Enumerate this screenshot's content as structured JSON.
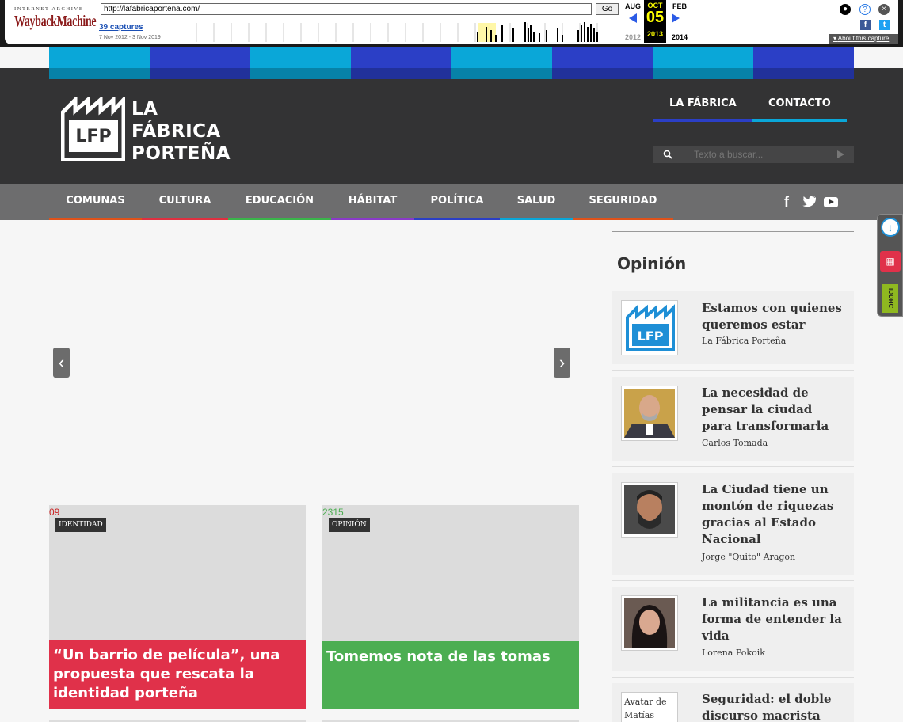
{
  "wayback": {
    "archive_label": "INTERNET ARCHIVE",
    "logo_label": "WaybackMachine",
    "url": "http://lafabricaportena.com/",
    "go_label": "Go",
    "captures_label": "39 captures",
    "date_range": "7 Nov 2012 - 3 Nov 2019",
    "prev_month": "AUG",
    "cur_month": "OCT",
    "next_month": "FEB",
    "cur_day": "05",
    "prev_year": "2012",
    "cur_year": "2013",
    "next_year": "2014",
    "about_label": "About this capture"
  },
  "strip_colors": [
    "#0aa7d8",
    "#2b3fc6",
    "#0aa7d8",
    "#2b3fc6",
    "#0aa7d8",
    "#2b3fc6",
    "#0aa7d8",
    "#2b3fc6"
  ],
  "header": {
    "logo_mark": "LFP",
    "logo_line1": "LA",
    "logo_line2": "FÁBRICA",
    "logo_line3": "PORTEÑA",
    "nav": [
      {
        "label": "LA FÁBRICA",
        "color": "#2b3fc6"
      },
      {
        "label": "CONTACTO",
        "color": "#0aa7d8"
      }
    ],
    "search_placeholder": "Texto a buscar..."
  },
  "categories": [
    {
      "label": "COMUNAS",
      "color": "#e0521a"
    },
    {
      "label": "CULTURA",
      "color": "#e03040"
    },
    {
      "label": "EDUCACIÓN",
      "color": "#3ab54a"
    },
    {
      "label": "HÁBITAT",
      "color": "#8a3ac8"
    },
    {
      "label": "POLÍTICA",
      "color": "#2b3fc6"
    },
    {
      "label": "SALUD",
      "color": "#0aa7d8"
    },
    {
      "label": "SEGURIDAD",
      "color": "#e0521a"
    }
  ],
  "social": [
    "f",
    "t",
    "▶"
  ],
  "cards": [
    {
      "img_alt": "09",
      "badge": "IDENTIDAD",
      "title": "“Un barrio de película”, una propuesta que rescata la identidad porteña",
      "color": "#e0314a"
    },
    {
      "img_alt": "2315",
      "badge": "OPINIÓN",
      "title": "Tomemos nota de las tomas",
      "color": "#4cae52"
    }
  ],
  "sidebar": {
    "title": "Opinión",
    "items": [
      {
        "title": "Estamos con quienes queremos estar",
        "author": "La Fábrica Porteña"
      },
      {
        "title": "La necesidad de pensar la ciudad para transformarla",
        "author": "Carlos Tomada"
      },
      {
        "title": "La Ciudad tiene un montón de riquezas gracias al Estado Nacional",
        "author": "Jorge \"Quito\" Aragon"
      },
      {
        "title": "La militancia es una forma de entender la vida",
        "author": "Lorena Pokoik"
      },
      {
        "title": "Seguridad: el doble discurso macrista",
        "author": "",
        "avatar_alt": "Avatar de Matías"
      }
    ]
  },
  "float_widget": {
    "label": "IDDHC"
  }
}
